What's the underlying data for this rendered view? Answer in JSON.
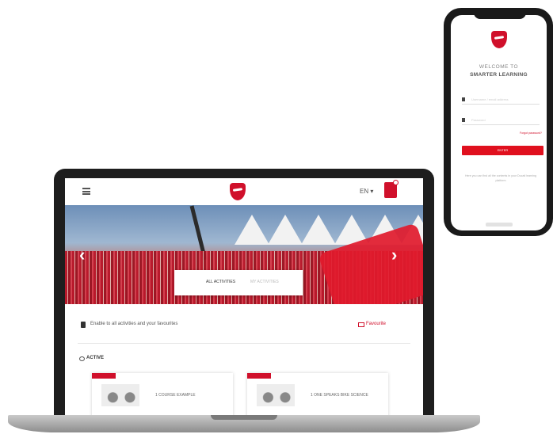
{
  "laptop": {
    "header": {
      "language": "EN ▾"
    },
    "banner": {
      "tabs": [
        "ALL ACTIVITIES",
        "MY ACTIVITIES"
      ],
      "arrow_prev": "‹",
      "arrow_next": "›"
    },
    "info": {
      "text": "Enable to all activities and your favourites",
      "link": "Favourite"
    },
    "section": {
      "title": "ACTIVE",
      "cards": [
        {
          "text": "1   COURSE EXAMPLE"
        },
        {
          "text": "1   ONE SPEAKS BIKE SCIENCE"
        }
      ]
    }
  },
  "phone": {
    "welcome": "WELCOME TO",
    "brand": "SMARTER LEARNING",
    "username_placeholder": "Username / email address",
    "password_placeholder": "Password",
    "forgot": "Forgot password?",
    "button": "ENTER",
    "info": "Here you can find all the contents in your Ducati learning platform"
  },
  "colors": {
    "accent": "#d0102b",
    "device": "#1e1e1e"
  }
}
